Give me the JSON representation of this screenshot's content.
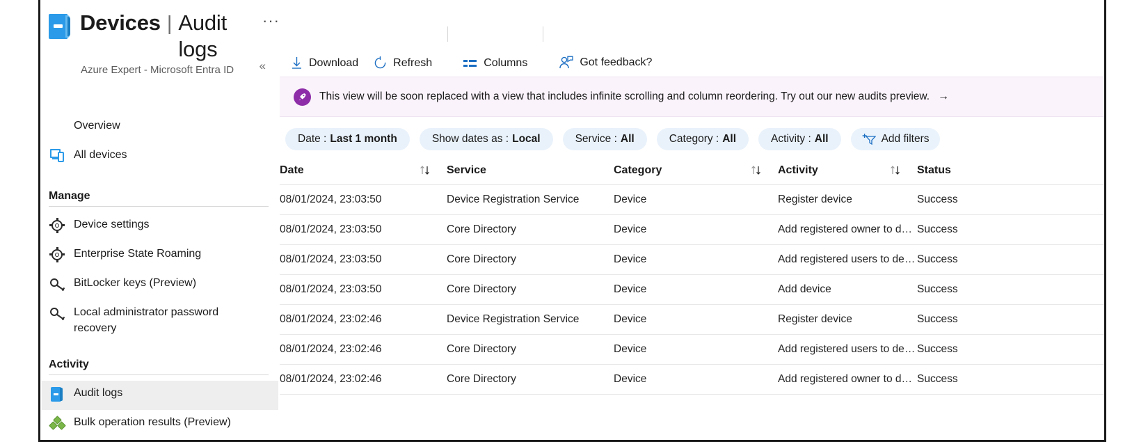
{
  "header": {
    "icon": "book-icon",
    "title_main": "Devices",
    "title_separator": "|",
    "title_sub": "Audit logs",
    "more_button": "···",
    "subtitle": "Azure Expert - Microsoft Entra ID",
    "collapse_icon": "«"
  },
  "sidebar": {
    "items": [
      {
        "label": "Overview",
        "icon": "info-icon",
        "selected": false
      },
      {
        "label": "All devices",
        "icon": "devices-icon",
        "selected": false
      }
    ],
    "groups": [
      {
        "title": "Manage",
        "items": [
          {
            "label": "Device settings",
            "icon": "gear-icon",
            "selected": false
          },
          {
            "label": "Enterprise State Roaming",
            "icon": "gear-icon",
            "selected": false
          },
          {
            "label": "BitLocker keys (Preview)",
            "icon": "key-icon",
            "selected": false
          },
          {
            "label": "Local administrator password recovery",
            "icon": "key-icon",
            "selected": false
          }
        ]
      },
      {
        "title": "Activity",
        "items": [
          {
            "label": "Audit logs",
            "icon": "book-icon",
            "selected": true
          },
          {
            "label": "Bulk operation results (Preview)",
            "icon": "bulk-icon",
            "selected": false
          }
        ]
      }
    ]
  },
  "toolbar": {
    "download_label": "Download",
    "refresh_label": "Refresh",
    "columns_label": "Columns",
    "feedback_label": "Got feedback?"
  },
  "banner": {
    "icon": "rocket-icon",
    "text": "This view will be soon replaced with a view that includes infinite scrolling and column reordering. Try out our new audits preview.",
    "arrow": "→",
    "background": "#faf3fb",
    "accent": "#8e2da8"
  },
  "filters": {
    "chips": [
      {
        "label": "Date :",
        "value": "Last 1 month"
      },
      {
        "label": "Show dates as :",
        "value": "Local"
      },
      {
        "label": "Service :",
        "value": "All"
      },
      {
        "label": "Category :",
        "value": "All"
      },
      {
        "label": "Activity :",
        "value": "All"
      }
    ],
    "add_filters_label": "Add filters",
    "add_filters_icon": "add-filter-icon",
    "chip_background": "#e9f2fb"
  },
  "table": {
    "columns": [
      {
        "label": "Date",
        "sortable": true
      },
      {
        "label": "Service",
        "sortable": false
      },
      {
        "label": "Category",
        "sortable": true
      },
      {
        "label": "Activity",
        "sortable": true
      },
      {
        "label": "Status",
        "sortable": false
      }
    ],
    "rows": [
      {
        "date": "08/01/2024, 23:03:50",
        "service": "Device Registration Service",
        "category": "Device",
        "activity": "Register device",
        "status": "Success"
      },
      {
        "date": "08/01/2024, 23:03:50",
        "service": "Core Directory",
        "category": "Device",
        "activity": "Add registered owner to de…",
        "status": "Success"
      },
      {
        "date": "08/01/2024, 23:03:50",
        "service": "Core Directory",
        "category": "Device",
        "activity": "Add registered users to dev…",
        "status": "Success"
      },
      {
        "date": "08/01/2024, 23:03:50",
        "service": "Core Directory",
        "category": "Device",
        "activity": "Add device",
        "status": "Success"
      },
      {
        "date": "08/01/2024, 23:02:46",
        "service": "Device Registration Service",
        "category": "Device",
        "activity": "Register device",
        "status": "Success"
      },
      {
        "date": "08/01/2024, 23:02:46",
        "service": "Core Directory",
        "category": "Device",
        "activity": "Add registered users to dev…",
        "status": "Success"
      },
      {
        "date": "08/01/2024, 23:02:46",
        "service": "Core Directory",
        "category": "Device",
        "activity": "Add registered owner to de…",
        "status": "Success"
      }
    ]
  }
}
